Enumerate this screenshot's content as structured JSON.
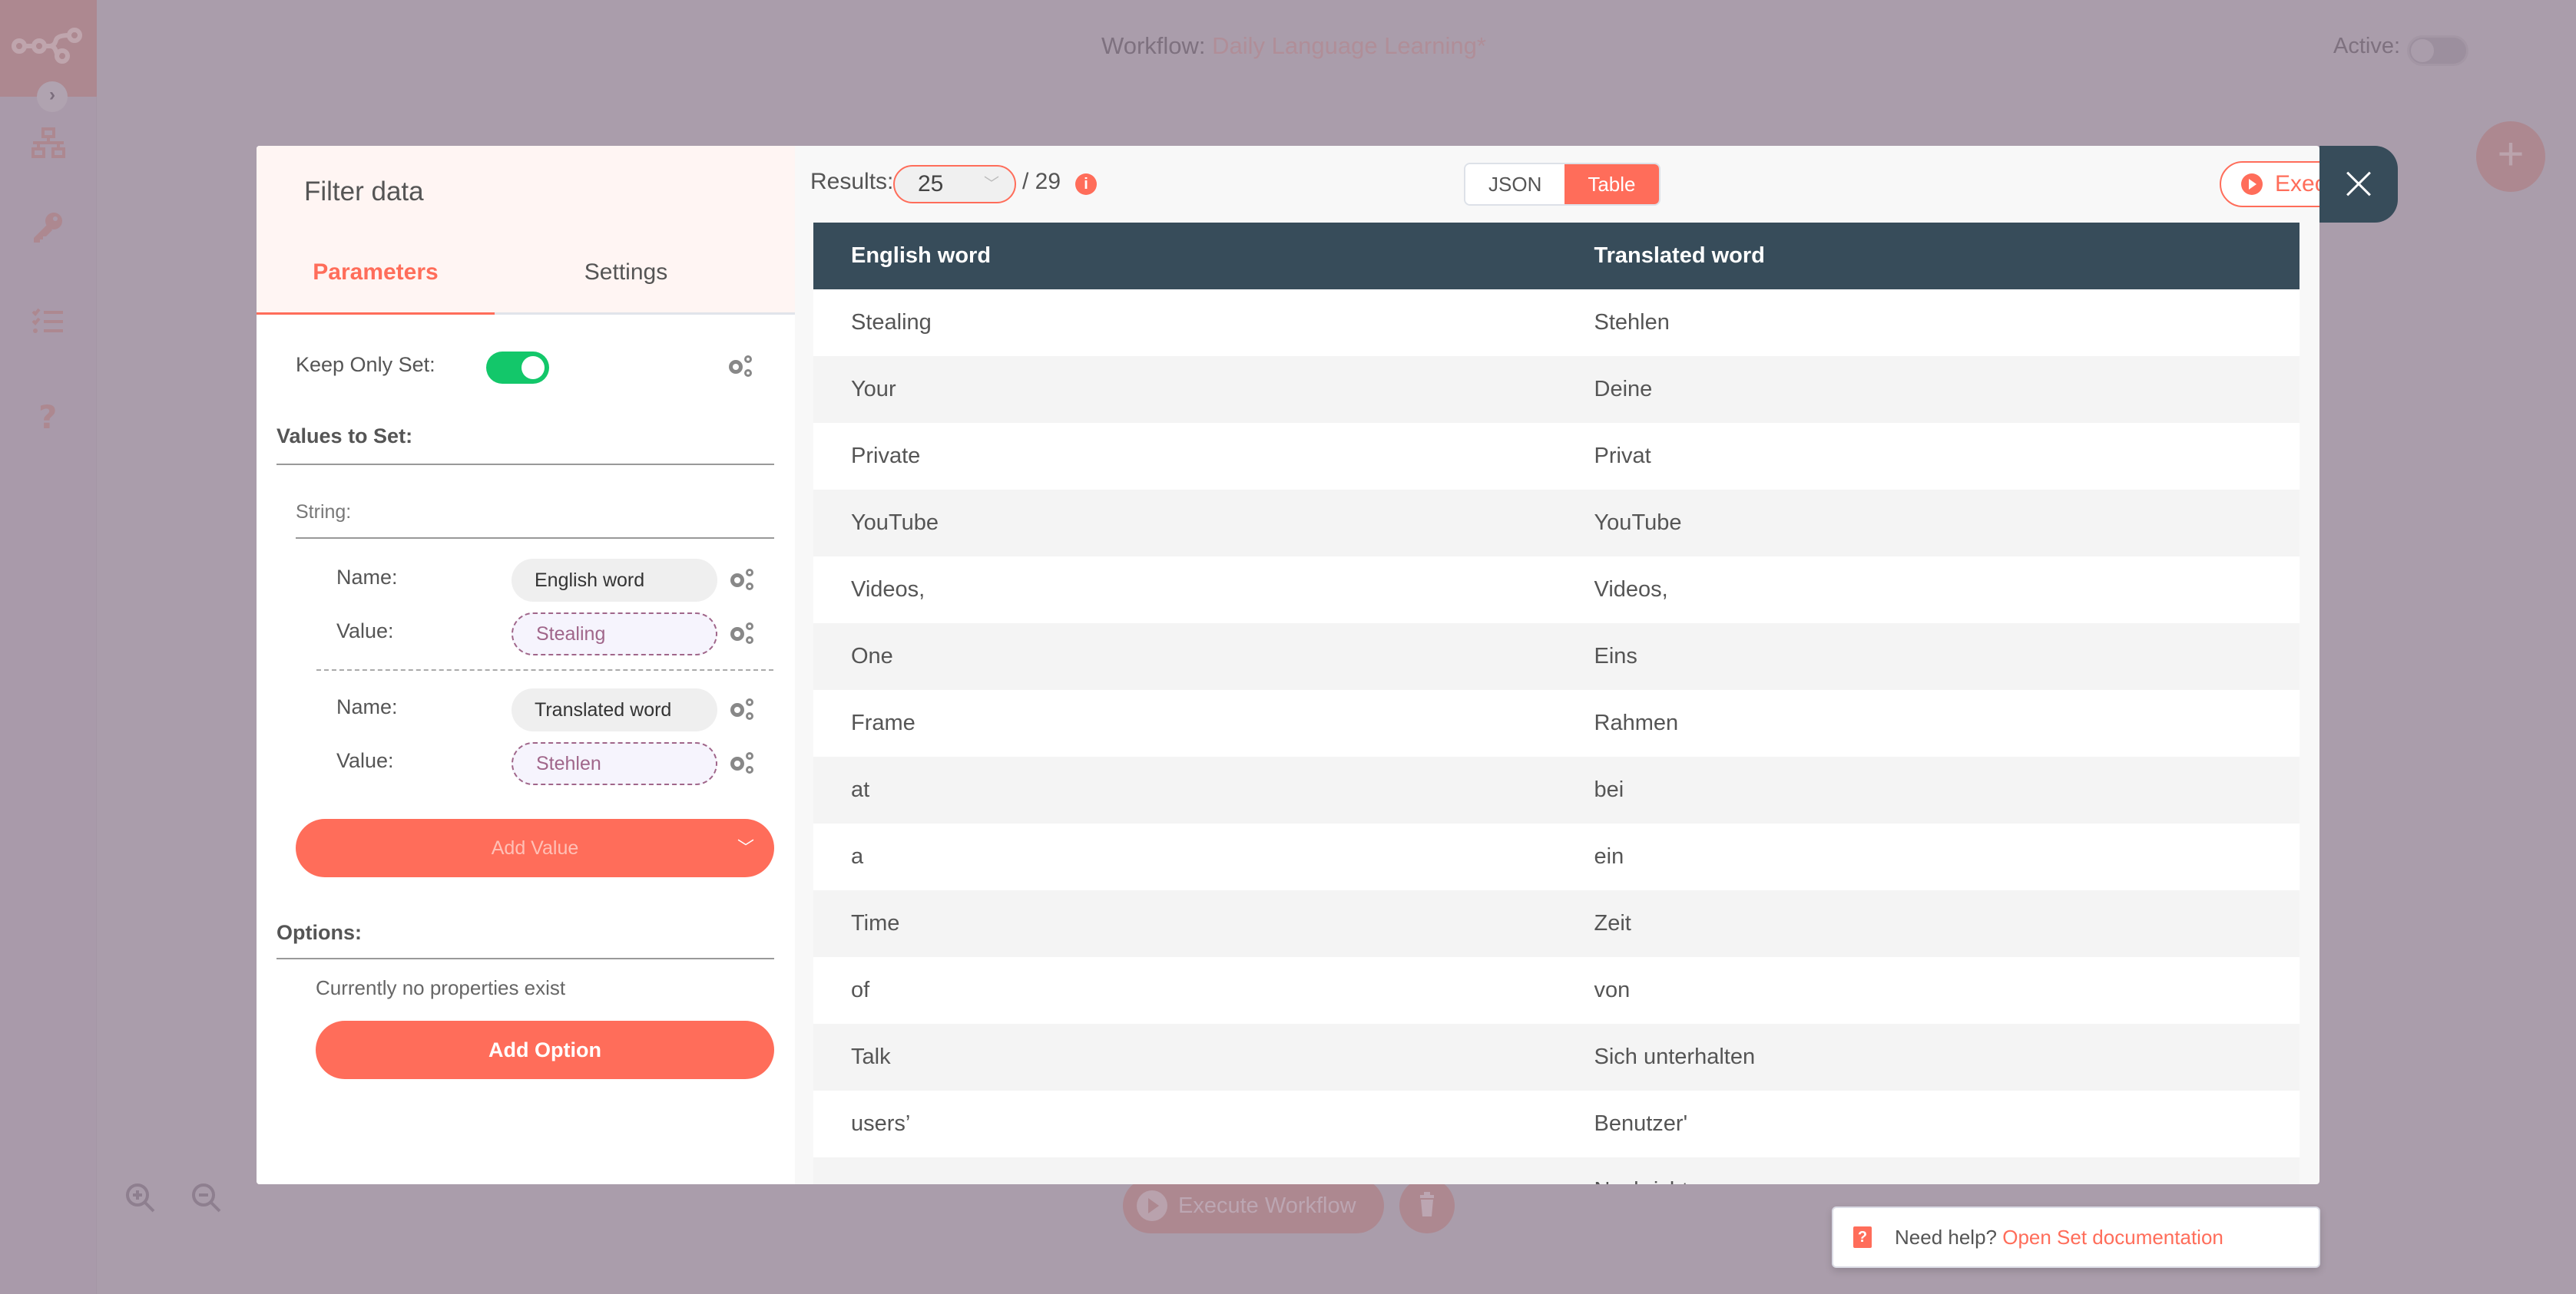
{
  "topbar": {
    "workflow_label": "Workflow:",
    "workflow_name": "Daily Language Learning*",
    "active_label": "Active:",
    "active_on": false
  },
  "sidebar": {
    "icons": [
      "logo-icon",
      "chevron-right-icon",
      "network-icon",
      "key-icon",
      "checklist-icon",
      "question-icon"
    ]
  },
  "canvas": {
    "execute_workflow_label": "Execute Workflow",
    "zoom_in": "zoom-in-icon",
    "zoom_out": "zoom-out-icon",
    "add_node": "plus-icon"
  },
  "node_panel": {
    "title": "Filter data",
    "tabs": [
      {
        "label": "Parameters",
        "active": true
      },
      {
        "label": "Settings",
        "active": false
      }
    ],
    "keep_only_set_label": "Keep Only Set:",
    "keep_only_set_on": true,
    "values_to_set_label": "Values to Set:",
    "string_label": "String:",
    "fields": [
      {
        "name_label": "Name:",
        "name_value": "English word",
        "value_label": "Value:",
        "value_value": "Stealing"
      },
      {
        "name_label": "Name:",
        "name_value": "Translated word",
        "value_label": "Value:",
        "value_value": "Stehlen"
      }
    ],
    "add_value_label": "Add Value",
    "options_label": "Options:",
    "no_properties_text": "Currently no properties exist",
    "add_option_label": "Add Option"
  },
  "output": {
    "results_label": "Results:",
    "results_selected": "25",
    "results_total": "/ 29",
    "view_modes": [
      {
        "label": "JSON",
        "active": false
      },
      {
        "label": "Table",
        "active": true
      }
    ],
    "execute_node_label": "Execute Node",
    "columns": [
      "English word",
      "Translated word"
    ],
    "rows": [
      [
        "Stealing",
        "Stehlen"
      ],
      [
        "Your",
        "Deine"
      ],
      [
        "Private",
        "Privat"
      ],
      [
        "YouTube",
        "YouTube"
      ],
      [
        "Videos,",
        "Videos,"
      ],
      [
        "One",
        "Eins"
      ],
      [
        "Frame",
        "Rahmen"
      ],
      [
        "at",
        "bei"
      ],
      [
        "a",
        "ein"
      ],
      [
        "Time",
        "Zeit"
      ],
      [
        "of",
        "von"
      ],
      [
        "Talk",
        "Sich unterhalten"
      ],
      [
        "users’",
        "Benutzer'"
      ],
      [
        "",
        "Nachricht"
      ]
    ]
  },
  "help": {
    "prefix": "Need help?",
    "link": "Open Set documentation"
  },
  "colors": {
    "accent": "#ff6d5a",
    "header_dark": "#374c5a",
    "toggle_on": "#13c76a",
    "expression_purple": "#a0668a"
  }
}
